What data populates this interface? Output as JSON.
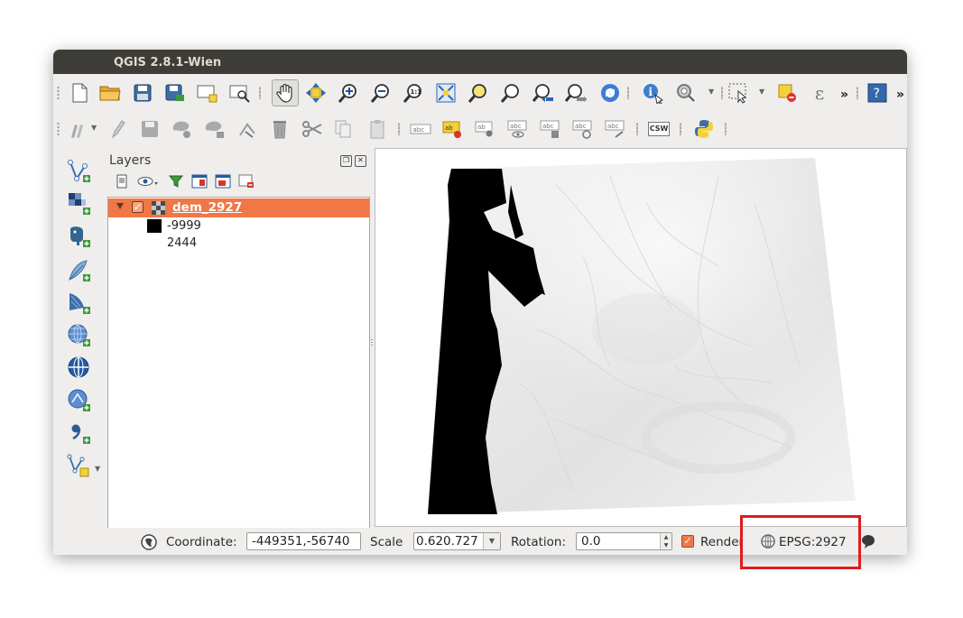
{
  "window": {
    "title": "QGIS 2.8.1-Wien"
  },
  "toolbar1": {
    "icons": [
      "new-project-icon",
      "open-project-icon",
      "save-project-icon",
      "save-as-icon",
      "new-print-composer-icon",
      "composer-manager-icon",
      "pan-map-icon",
      "pan-to-selection-icon",
      "zoom-in-icon",
      "zoom-out-icon",
      "zoom-native-icon",
      "zoom-full-icon",
      "zoom-to-selection-icon",
      "zoom-to-layer-icon",
      "zoom-last-icon",
      "zoom-next-icon",
      "refresh-icon",
      "identify-icon",
      "measure-icon",
      "select-icon",
      "deselect-icon",
      "expression-icon",
      "help-icon"
    ],
    "overflow": "»",
    "expression_symbol": "ε"
  },
  "toolbar2": {
    "label_tool_text": "abc",
    "csw_text": "CSW"
  },
  "layers_panel": {
    "title": "Layers",
    "layer": {
      "name": "dem_2927",
      "checked": true
    },
    "legend": {
      "min_label": "-9999",
      "max_label": "2444"
    }
  },
  "statusbar": {
    "coordinate_label": "Coordinate:",
    "coordinate_value": "-449351,-56740",
    "scale_label": "Scale",
    "scale_value": "0.620.727",
    "rotation_label": "Rotation:",
    "rotation_value": "0.0",
    "render_label": "Render",
    "crs_value": "EPSG:2927"
  },
  "colors": {
    "titlebar": "#3d3c37",
    "selection": "#f07746",
    "highlight_box": "#e01b1b"
  }
}
